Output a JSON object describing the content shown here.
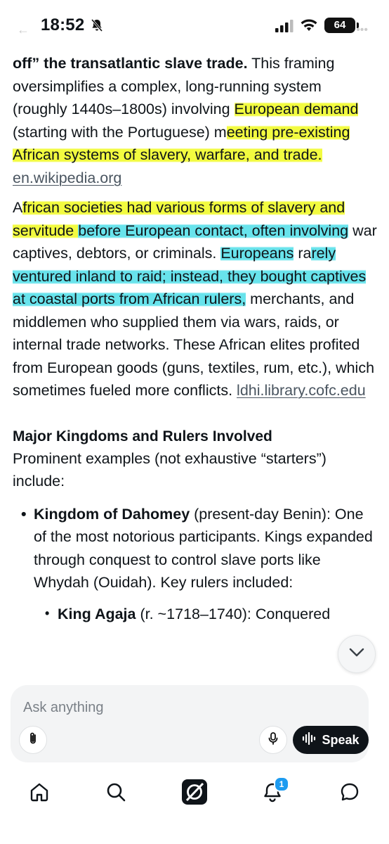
{
  "status_bar": {
    "time": "18:52",
    "battery": "64"
  },
  "article": {
    "p1": {
      "bold_lead": "off” the transatlantic slave trade.",
      "t1": " This framing oversimplifies a complex, long-running system (roughly 1440s–1800s) involving ",
      "h1": "European demand",
      "t2": " (starting with the Portuguese) m",
      "h2": "eeting pre-existing African systems of slavery, warfare, and trade.",
      "t3": " ",
      "link": "en.wikipedia.org"
    },
    "p2": {
      "t0": "A",
      "y1": "frican societies had various forms of slavery and servit",
      "y2": "ude ",
      "c1": "before European contact, often involving",
      "t1": " war captives, debtors, or criminals. ",
      "c2": "Europeans",
      "t2": " ra",
      "c3": "rely ventured inland to raid; instead, they bought captives at coastal ports from African rulers,",
      "t3": " merchants, and middlemen who supplied them via wars, raids, or internal trade networks. These African elites profited from European goods (guns, textiles, rum, etc.), which sometimes fueled more conflicts. ",
      "link": "ldhi.library.cofc.edu"
    },
    "section_title": "Major Kingdoms and Rulers Involved",
    "intro": "Prominent examples (not exhaustive “starters”) include:",
    "bullet1": {
      "bold": "Kingdom of Dahomey",
      "rest": " (present-day Benin): One of the most notorious participants. Kings expanded through conquest to control slave ports like Whydah (Ouidah). Key rulers included:"
    },
    "sub_bullet1": {
      "bold": "King Agaja",
      "rest": " (r. ~1718–1740): Conquered"
    }
  },
  "composer": {
    "placeholder": "Ask anything",
    "speak_label": "Speak"
  },
  "nav": {
    "notifications_count": "1"
  },
  "colors": {
    "highlight_yellow": "#f0fa1e",
    "highlight_cyan": "#4edee8",
    "speak_bg": "#0f1419",
    "badge": "#1d9bf0"
  }
}
